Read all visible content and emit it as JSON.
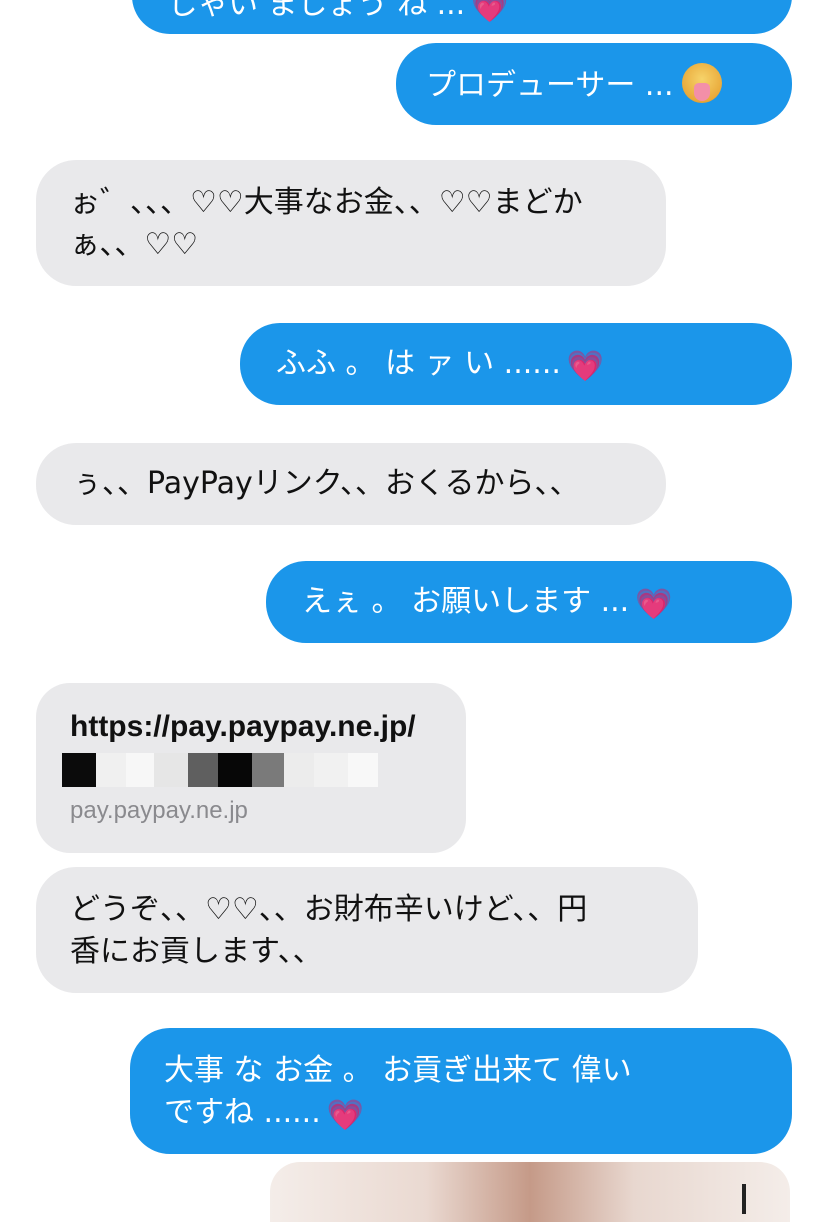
{
  "messages": [
    {
      "id": "m0",
      "direction": "out",
      "text": "じゃい  ましょう  ね  ...",
      "emoji": "heart-pink"
    },
    {
      "id": "m1",
      "direction": "out",
      "text": "プロデューサー   ...",
      "emoji": "tongue-face"
    },
    {
      "id": "m2",
      "direction": "in",
      "lines": [
        "ぉ゛、、、♡♡大事なお金、、♡♡まどか",
        "ぁ、、♡♡"
      ]
    },
    {
      "id": "m3",
      "direction": "out",
      "text": "ふふ      。   は   ァ   い   ......",
      "emoji": "heart-pink"
    },
    {
      "id": "m4",
      "direction": "in",
      "text": "ぅ、、PayPayリンク、、おくるから、、"
    },
    {
      "id": "m5",
      "direction": "out",
      "text": "えぇ   。   お願いします   ...",
      "emoji": "heart-pink"
    },
    {
      "id": "m6",
      "direction": "in",
      "type": "link",
      "url_text": "https://pay.paypay.ne.jp/",
      "domain": "pay.paypay.ne.jp"
    },
    {
      "id": "m7",
      "direction": "in",
      "lines": [
        "どうぞ、、♡♡、、お財布辛いけど、、円",
        "香にお貢します、、"
      ]
    },
    {
      "id": "m8",
      "direction": "out",
      "lines": [
        "大事   な   お金   。   お貢ぎ出来て   偉い",
        "ですね   ......"
      ],
      "emoji": "heart-pink"
    }
  ],
  "glyphs": {
    "heart": "💗"
  },
  "colors": {
    "outgoing_bubble": "#1b96ea",
    "incoming_bubble": "#e9e9eb",
    "link_domain": "#8a8a8e"
  }
}
